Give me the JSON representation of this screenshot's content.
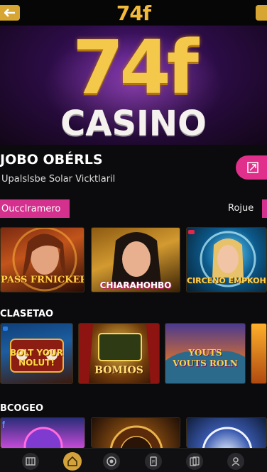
{
  "header": {
    "logo_text": "74f",
    "back_icon": "arrow-left-icon",
    "menu_icon": "menu-icon"
  },
  "hero": {
    "logo_text": "74f",
    "casino_text": "CASINO"
  },
  "promo": {
    "title": "JOBO OBÉRLS",
    "subtitle": "Upalslsbe Solar Vicktlaril",
    "action_icon": "expand-icon",
    "accent": "#e12f8c"
  },
  "tabs": {
    "active_label": "Oucclramero",
    "other_label": "Rojue"
  },
  "row1": {
    "cards": [
      {
        "title": "PASS FRNICKER"
      },
      {
        "title": "CHIARAHOHBO"
      },
      {
        "title": "CIRCENO EMPKOHO"
      }
    ]
  },
  "section2": {
    "title": "CLASETAO",
    "cards": [
      {
        "title": "BOLT YOUR NOLUT!"
      },
      {
        "title": "BOMIOS"
      },
      {
        "title": "YOUTS VOUTS ROLN"
      }
    ]
  },
  "section3": {
    "title": "BCOGEO"
  },
  "bottom_nav": {
    "items": [
      {
        "icon": "slots-icon"
      },
      {
        "icon": "home-icon"
      },
      {
        "icon": "chip-icon"
      },
      {
        "icon": "poker-icon"
      },
      {
        "icon": "profile-icon"
      }
    ]
  }
}
